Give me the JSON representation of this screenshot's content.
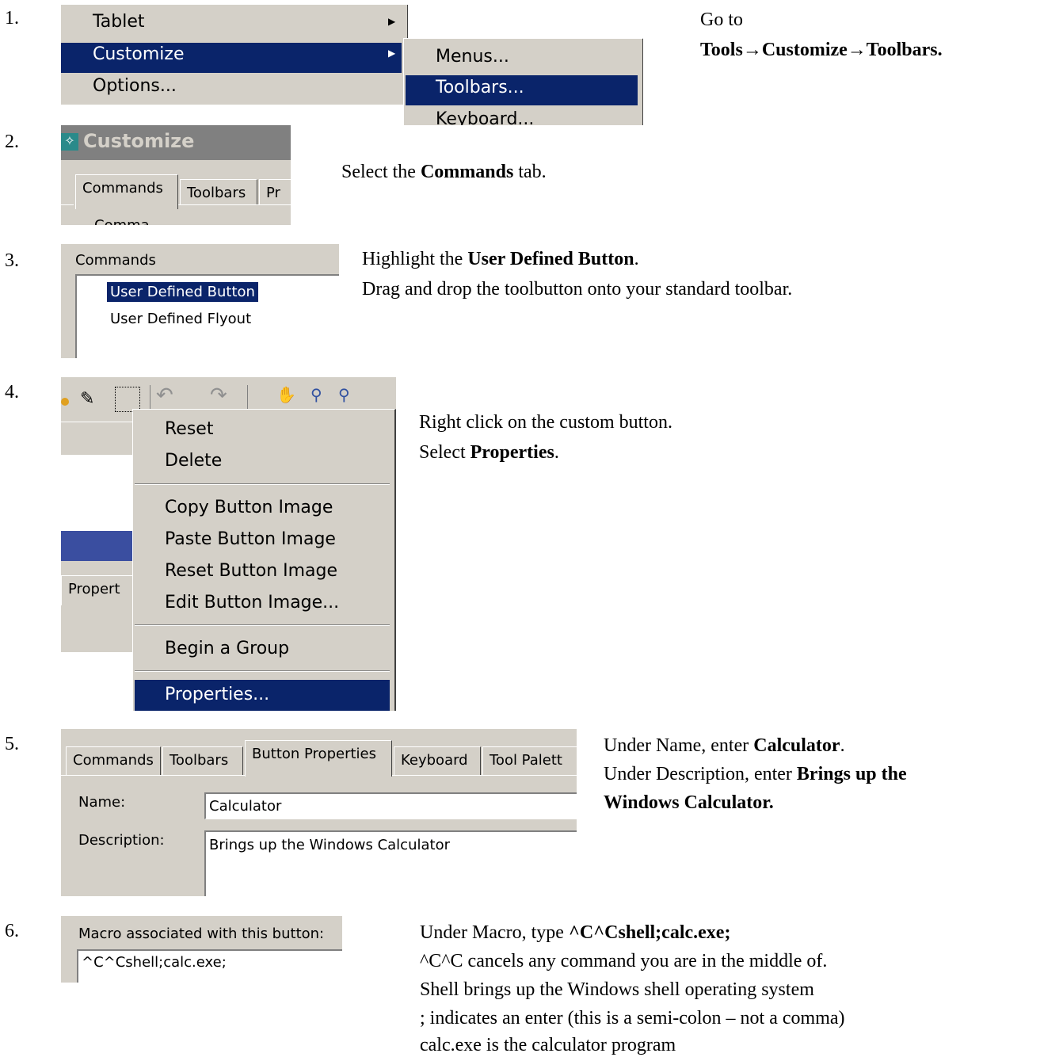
{
  "steps": [
    {
      "number": "1.",
      "menu": {
        "left_items": [
          "Tablet",
          "Customize",
          "Options..."
        ],
        "sub_items": [
          "Menus...",
          "Toolbars...",
          "Keyboard..."
        ]
      },
      "text": {
        "line1": "Go to",
        "line2_bold": "Tools→Customize→Toolbars",
        "line2_end": "."
      }
    },
    {
      "number": "2.",
      "dialog": {
        "title": "Customize",
        "tabs": [
          "Commands",
          "Toolbars",
          "Pr"
        ],
        "cut_label": "Comma"
      },
      "text": {
        "pre": "Select the ",
        "bold": "Commands",
        "post": " tab."
      }
    },
    {
      "number": "3.",
      "list": {
        "label": "Commands",
        "items": [
          "User Defined Button",
          "User Defined Flyout"
        ]
      },
      "text": {
        "line1_pre": "Highlight the ",
        "line1_bold": "User Defined Button",
        "line1_post": ".",
        "line2": "Drag and drop the toolbutton onto your standard toolbar."
      }
    },
    {
      "number": "4.",
      "context_menu": {
        "items": [
          "Reset",
          "Delete",
          "Copy Button Image",
          "Paste Button Image",
          "Reset Button Image",
          "Edit Button Image...",
          "Begin a Group",
          "Properties..."
        ],
        "bg_tab": "Propert"
      },
      "text": {
        "line1": "Right click on the custom button.",
        "line2_pre": "Select ",
        "line2_bold": "Properties",
        "line2_post": "."
      }
    },
    {
      "number": "5.",
      "properties": {
        "tabs": [
          "Commands",
          "Toolbars",
          "Button Properties",
          "Keyboard",
          "Tool Palett"
        ],
        "name_label": "Name:",
        "name_value": "Calculator",
        "desc_label": "Description:",
        "desc_value": "Brings up the Windows Calculator"
      },
      "text": {
        "line1_pre": "Under Name, enter ",
        "line1_bold": "Calculator",
        "line1_post": ".",
        "line2_pre": "Under Description, enter ",
        "line2_bold": "Brings up the",
        "line3_bold": "Windows Calculator."
      }
    },
    {
      "number": "6.",
      "macro": {
        "label": "Macro associated with this button:",
        "value": "^C^Cshell;calc.exe;"
      },
      "text": {
        "line1_pre": "Under Macro, type ",
        "line1_bold": "^C^Cshell;calc.exe;",
        "line2": "^C^C cancels any command you are in the middle of.",
        "line3": "Shell brings up the Windows shell operating system",
        "line4": "; indicates an enter (this is a semi-colon – not a comma)",
        "line5": "calc.exe is the calculator program"
      }
    }
  ]
}
